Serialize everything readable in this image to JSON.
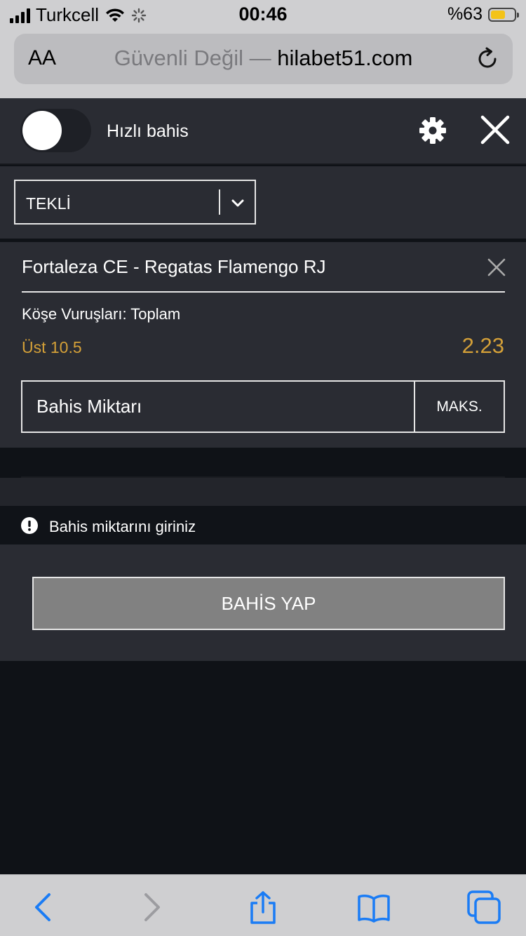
{
  "status_bar": {
    "carrier": "Turkcell",
    "time": "00:46",
    "battery": "%63",
    "battery_level": 0.63,
    "battery_color": "#f3c318"
  },
  "browser": {
    "text_size_label": "AA",
    "security_label": "Güvenli Değil —",
    "host": "hilabet51.com"
  },
  "betslip": {
    "quick_bet_label": "Hızlı bahis",
    "quick_bet_on": false,
    "bet_type": "TEKLİ",
    "match": "Fortaleza CE - Regatas Flamengo RJ",
    "market": "Köşe Vuruşları: Toplam",
    "selection": "Üst 10.5",
    "odds": "2.23",
    "stake_placeholder": "Bahis Miktarı",
    "max_label": "MAKS.",
    "warning": "Bahis miktarını giriniz",
    "place_bet_label": "BAHİS YAP",
    "accent_color": "#d4a038"
  },
  "toolbar": {
    "icons": [
      "back-icon",
      "forward-icon",
      "share-icon",
      "bookmarks-icon",
      "tabs-icon"
    ],
    "active_color": "#1a7cf5"
  }
}
